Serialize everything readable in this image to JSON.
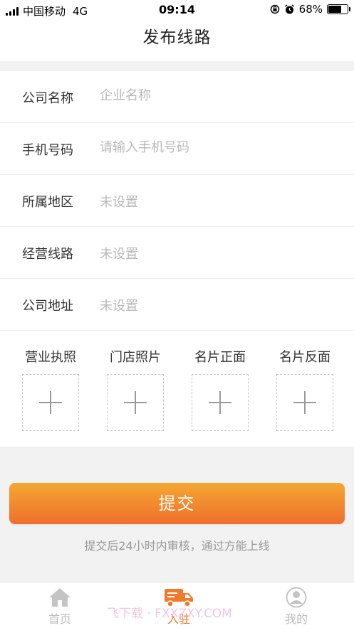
{
  "status_bar": {
    "carrier": "中国移动",
    "network": "4G",
    "time": "09:14",
    "battery": "68%",
    "battery_level": 0.68
  },
  "nav": {
    "title": "发布线路"
  },
  "form": {
    "rows": [
      {
        "label": "公司名称",
        "placeholder": "企业名称"
      },
      {
        "label": "手机号码",
        "placeholder": "请输入手机号码"
      },
      {
        "label": "所属地区",
        "value": "未设置"
      },
      {
        "label": "经营线路",
        "value": "未设置"
      },
      {
        "label": "公司地址",
        "value": "未设置"
      }
    ],
    "uploads": [
      {
        "label": "营业执照"
      },
      {
        "label": "门店照片"
      },
      {
        "label": "名片正面"
      },
      {
        "label": "名片反面"
      }
    ]
  },
  "submit": {
    "label": "提交",
    "hint": "提交后24小时内审核，通过方能上线"
  },
  "tabs": [
    {
      "label": "首页",
      "icon": "home-icon",
      "active": false
    },
    {
      "label": "入驻",
      "icon": "truck-icon",
      "active": true
    },
    {
      "label": "我的",
      "icon": "user-icon",
      "active": false
    }
  ],
  "colors": {
    "accent": "#f07a2a",
    "button_top": "#f5a732",
    "button_bottom": "#ef6f2c"
  },
  "watermark": "飞下载 · FXXZXY.COM"
}
